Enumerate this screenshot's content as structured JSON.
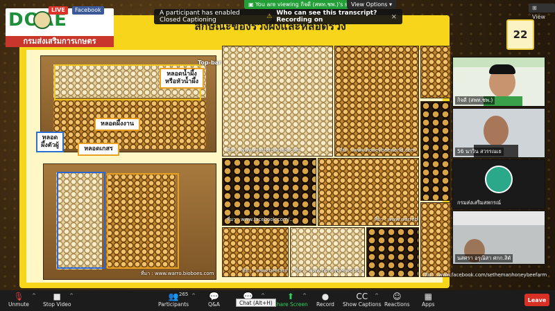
{
  "logo": {
    "top_text": "DOAE",
    "bottom_text": "กรมส่งเสริมการเกษตร",
    "live": "LIVE",
    "facebook": "Facebook"
  },
  "banners": {
    "share": "You are viewing กิจดี (สพท.ชพ.)'s screen",
    "view_options": "View Options",
    "view": "View",
    "cc_message": "A participant has enabled Closed Captioning",
    "cc_question": "Who can see this transcript? Recording on",
    "cc_close": "×"
  },
  "slide": {
    "title": "ลักษณะของรวงผึ้งและหลอดรวง",
    "page_number": "22",
    "topbar_label": "Top-bar",
    "labels": {
      "queen_cell": "หลอดน้ำผึ้ง\nหรือหัวน้ำผึ้ง",
      "worker_cell": "หลอดผึ้งงาน",
      "drone_cell": "หลอด\nผึ้งตัวผู้",
      "pollen_cell": "หลอดเกสร"
    },
    "watermarks": [
      "ที่มา : www.warrо.bioboes.com",
      "ที่มา : www.masterdianaol.com",
      "ที่มา : www.honeybeeworld.com",
      "ที่มา : www.facebook.com/...",
      "ที่มา : www.warrebioboes.com",
      "ที่มา : www.beefarm.com",
      "ที่มา : www.honeybeeworld.com",
      "ที่มา : www.facebook.com/sethemanhoneybeefarm"
    ]
  },
  "participants_tiles": [
    {
      "name": "กิจดี (สพท.ชพ.)"
    },
    {
      "name": "56 นาวิน สวรรณเย"
    },
    {
      "name": "กรมส่งเสริมสหกรณ์"
    },
    {
      "name": "นสศรา อรุณิสา ศกก.สิตั"
    }
  ],
  "toolbar": {
    "unmute": "Unmute",
    "stop_video": "Stop Video",
    "participants": "Participants",
    "participants_count": "265",
    "qa": "Q&A",
    "chat_tooltip": "Chat (Alt+H)",
    "share_screen": "Share Screen",
    "record": "Record",
    "show_captions": "Show Captions",
    "reactions": "Reactions",
    "apps": "Apps",
    "leave": "Leave"
  },
  "colors": {
    "slide_yellow": "#f6d51a",
    "zoom_green": "#22a037",
    "leave_red": "#d93025"
  }
}
